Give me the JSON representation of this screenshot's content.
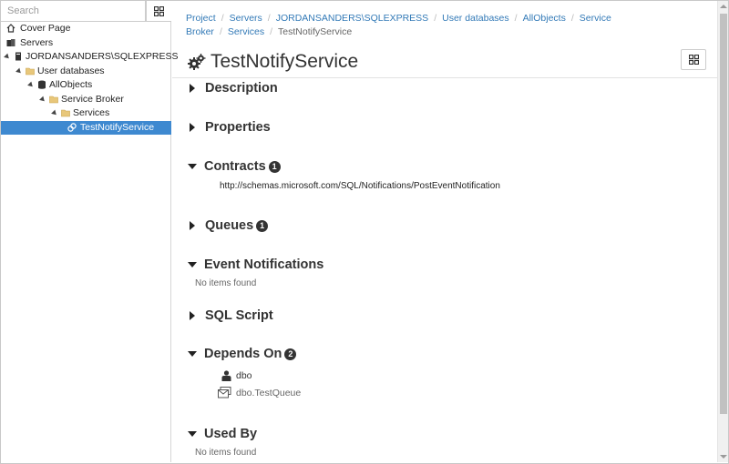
{
  "search": {
    "placeholder": "Search"
  },
  "tree": [
    {
      "label": "Cover Page",
      "icon": "home-icon",
      "indent": 0,
      "expander": false
    },
    {
      "label": "Servers",
      "icon": "servers-icon",
      "indent": 0,
      "expander": false
    },
    {
      "label": "JORDANSANDERS\\SQLEXPRESS",
      "icon": "server-icon",
      "indent": 0,
      "expander": true
    },
    {
      "label": "User databases",
      "icon": "folder-icon",
      "indent": 1,
      "expander": true
    },
    {
      "label": "AllObjects",
      "icon": "database-icon",
      "indent": 2,
      "expander": true
    },
    {
      "label": "Service Broker",
      "icon": "folder-icon",
      "indent": 3,
      "expander": true
    },
    {
      "label": "Services",
      "icon": "folder-icon",
      "indent": 4,
      "expander": true
    },
    {
      "label": "TestNotifyService",
      "icon": "service-icon",
      "indent": 5,
      "expander": false,
      "selected": true
    }
  ],
  "breadcrumb": {
    "items": [
      "Project",
      "Servers",
      "JORDANSANDERS\\SQLEXPRESS",
      "User databases",
      "AllObjects",
      "Service Broker",
      "Services"
    ],
    "current": "TestNotifyService"
  },
  "page": {
    "title": "TestNotifyService"
  },
  "sections": {
    "description": {
      "title": "Description"
    },
    "properties": {
      "title": "Properties"
    },
    "contracts": {
      "title": "Contracts",
      "count": "1",
      "items": [
        "http://schemas.microsoft.com/SQL/Notifications/PostEventNotification"
      ]
    },
    "queues": {
      "title": "Queues",
      "count": "1"
    },
    "event_notifications": {
      "title": "Event Notifications",
      "empty": "No items found"
    },
    "sql_script": {
      "title": "SQL Script"
    },
    "depends_on": {
      "title": "Depends On",
      "count": "2",
      "items": [
        {
          "label": "dbo",
          "icon": "user-icon"
        },
        {
          "label": "dbo.TestQueue",
          "icon": "queue-icon"
        }
      ]
    },
    "used_by": {
      "title": "Used By",
      "empty": "No items found"
    }
  },
  "colors": {
    "accent": "#3e89d0",
    "link": "#337ab7",
    "badge": "#333333"
  }
}
